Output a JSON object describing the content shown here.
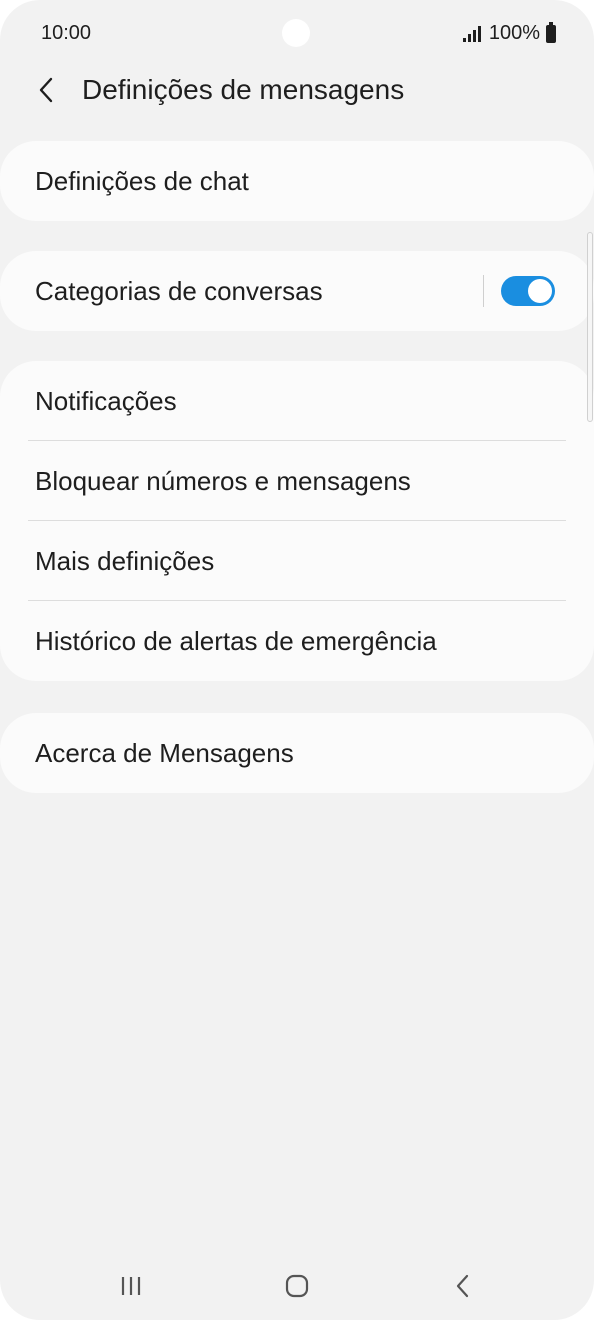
{
  "status_bar": {
    "time": "10:00",
    "battery": "100%",
    "icons": [
      "signal-icon",
      "battery-icon"
    ]
  },
  "header": {
    "title": "Definições de mensagens",
    "back_icon": "back-arrow-icon"
  },
  "groups": [
    {
      "items": [
        {
          "label": "Definições de chat"
        }
      ]
    },
    {
      "items": [
        {
          "label": "Categorias de conversas",
          "toggle": true
        }
      ]
    },
    {
      "items": [
        {
          "label": "Notificações"
        },
        {
          "label": "Bloquear números e mensagens"
        },
        {
          "label": "Mais definições"
        },
        {
          "label": "Histórico de alertas de emergência"
        }
      ]
    },
    {
      "items": [
        {
          "label": "Acerca de Mensagens"
        }
      ]
    }
  ],
  "colors": {
    "background": "#f2f2f2",
    "card": "#fbfbfb",
    "accent": "#1a8ee0"
  },
  "nav_bar": {
    "icons": [
      "recent-apps-icon",
      "home-icon",
      "back-icon"
    ]
  }
}
